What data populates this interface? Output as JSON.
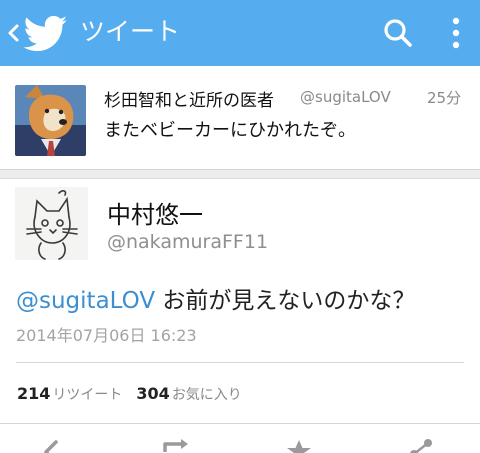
{
  "header": {
    "title": "ツイート",
    "colors": {
      "bar": "#55acee",
      "icon": "#ffffff"
    }
  },
  "previous_tweet": {
    "name": "杉田智和と近所の医者",
    "handle": "@sugitaLOV",
    "time": "25分",
    "text": "またベビーカーにひかれたぞ。"
  },
  "tweet": {
    "name": "中村悠一",
    "handle": "@nakamuraFF11",
    "mention": "@sugitaLOV",
    "body": " お前が見えないのかな？",
    "timestamp": "2014年07月06日 16:23",
    "retweets": "214",
    "retweets_label": "リツイート",
    "favorites": "304",
    "favorites_label": "お気に入り"
  },
  "icons": {
    "back": "chevron-left-icon",
    "logo": "twitter-bird-icon",
    "search": "search-icon",
    "more": "more-vertical-icon",
    "reply": "reply-icon",
    "retweet": "retweet-icon",
    "favorite": "star-icon",
    "share": "share-icon"
  }
}
